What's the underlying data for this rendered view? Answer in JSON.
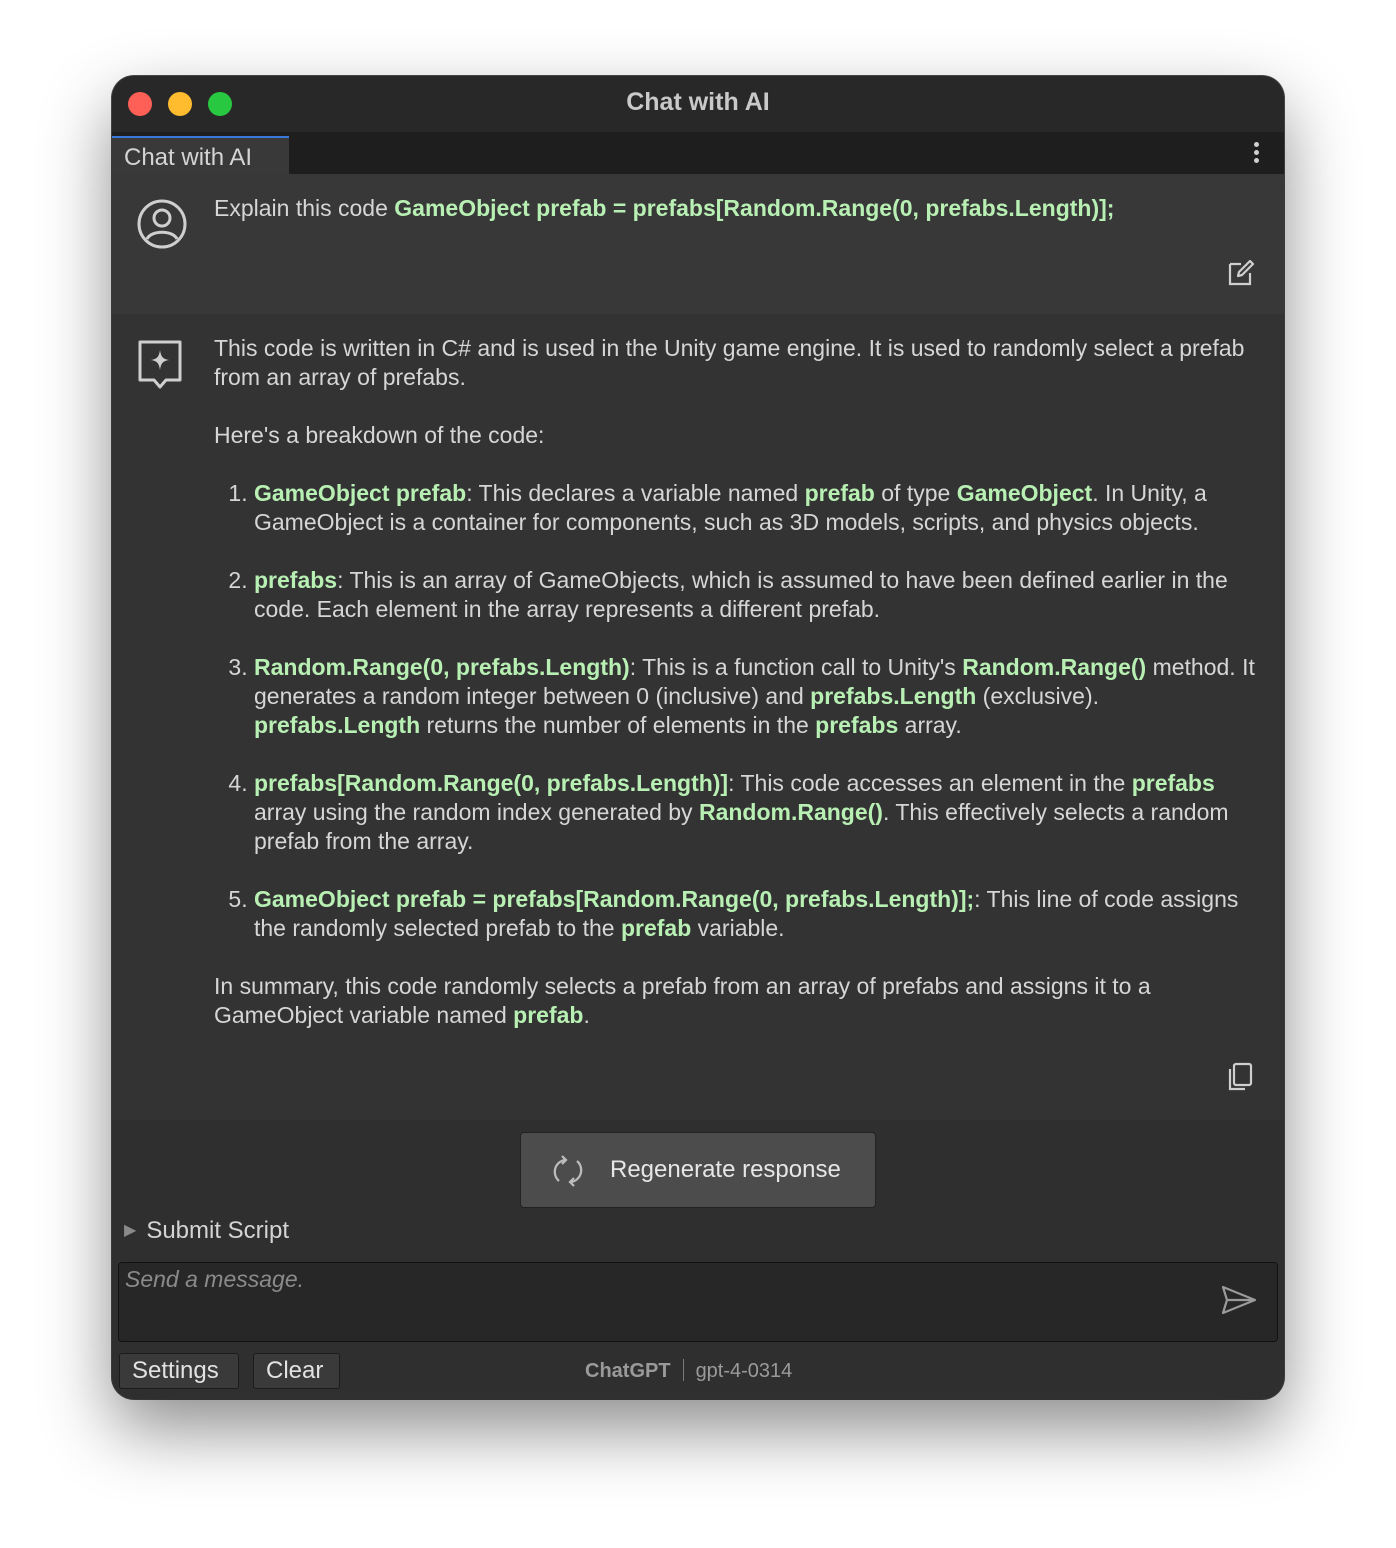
{
  "window": {
    "title": "Chat with AI"
  },
  "tabs": [
    {
      "label": "Chat with AI"
    }
  ],
  "user_message": {
    "prefix": "Explain this code ",
    "code": "GameObject prefab = prefabs[Random.Range(0, prefabs.Length)];"
  },
  "assistant_message": {
    "intro": "This code is written in C# and is used in the Unity game engine. It is used to randomly select a prefab from an array of prefabs.",
    "breakdown_heading": "Here's a breakdown of the code:",
    "items": [
      [
        {
          "t": "GameObject prefab",
          "c": true
        },
        {
          "t": ": This declares a variable named ",
          "c": false
        },
        {
          "t": "prefab",
          "c": true
        },
        {
          "t": " of type ",
          "c": false
        },
        {
          "t": "GameObject",
          "c": true
        },
        {
          "t": ". In Unity, a GameObject is a container for components, such as 3D models, scripts, and physics objects.",
          "c": false
        }
      ],
      [
        {
          "t": "prefabs",
          "c": true
        },
        {
          "t": ": This is an array of GameObjects, which is assumed to have been defined earlier in the code. Each element in the array represents a different prefab.",
          "c": false
        }
      ],
      [
        {
          "t": "Random.Range(0, prefabs.Length)",
          "c": true
        },
        {
          "t": ": This is a function call to Unity's ",
          "c": false
        },
        {
          "t": "Random.Range()",
          "c": true
        },
        {
          "t": " method. It generates a random integer between 0 (inclusive) and ",
          "c": false
        },
        {
          "t": "prefabs.Length",
          "c": true
        },
        {
          "t": " (exclusive). ",
          "c": false
        },
        {
          "t": "prefabs.Length",
          "c": true
        },
        {
          "t": " returns the number of elements in the ",
          "c": false
        },
        {
          "t": "prefabs",
          "c": true
        },
        {
          "t": " array.",
          "c": false
        }
      ],
      [
        {
          "t": "prefabs[Random.Range(0, prefabs.Length)]",
          "c": true
        },
        {
          "t": ": This code accesses an element in the ",
          "c": false
        },
        {
          "t": "prefabs",
          "c": true
        },
        {
          "t": " array using the random index generated by ",
          "c": false
        },
        {
          "t": "Random.Range()",
          "c": true
        },
        {
          "t": ". This effectively selects a random prefab from the array.",
          "c": false
        }
      ],
      [
        {
          "t": "GameObject prefab = prefabs[Random.Range(0, prefabs.Length)];",
          "c": true
        },
        {
          "t": ": This line of code assigns the randomly selected prefab to the ",
          "c": false
        },
        {
          "t": "prefab",
          "c": true
        },
        {
          "t": " variable.",
          "c": false
        }
      ]
    ],
    "summary_text": "In summary, this code randomly selects a prefab from an array of prefabs and assigns it to a GameObject variable named ",
    "summary_code": "prefab",
    "summary_end": "."
  },
  "regenerate_label": "Regenerate response",
  "submit_script_label": "Submit Script",
  "composer": {
    "placeholder": "Send a message."
  },
  "footer": {
    "settings_label": "Settings",
    "clear_label": "Clear",
    "provider": "ChatGPT",
    "model": "gpt-4-0314"
  },
  "colors": {
    "code_highlight": "#b8f0b4",
    "text": "#d6d6d6",
    "tab_accent": "#3a79d7"
  }
}
